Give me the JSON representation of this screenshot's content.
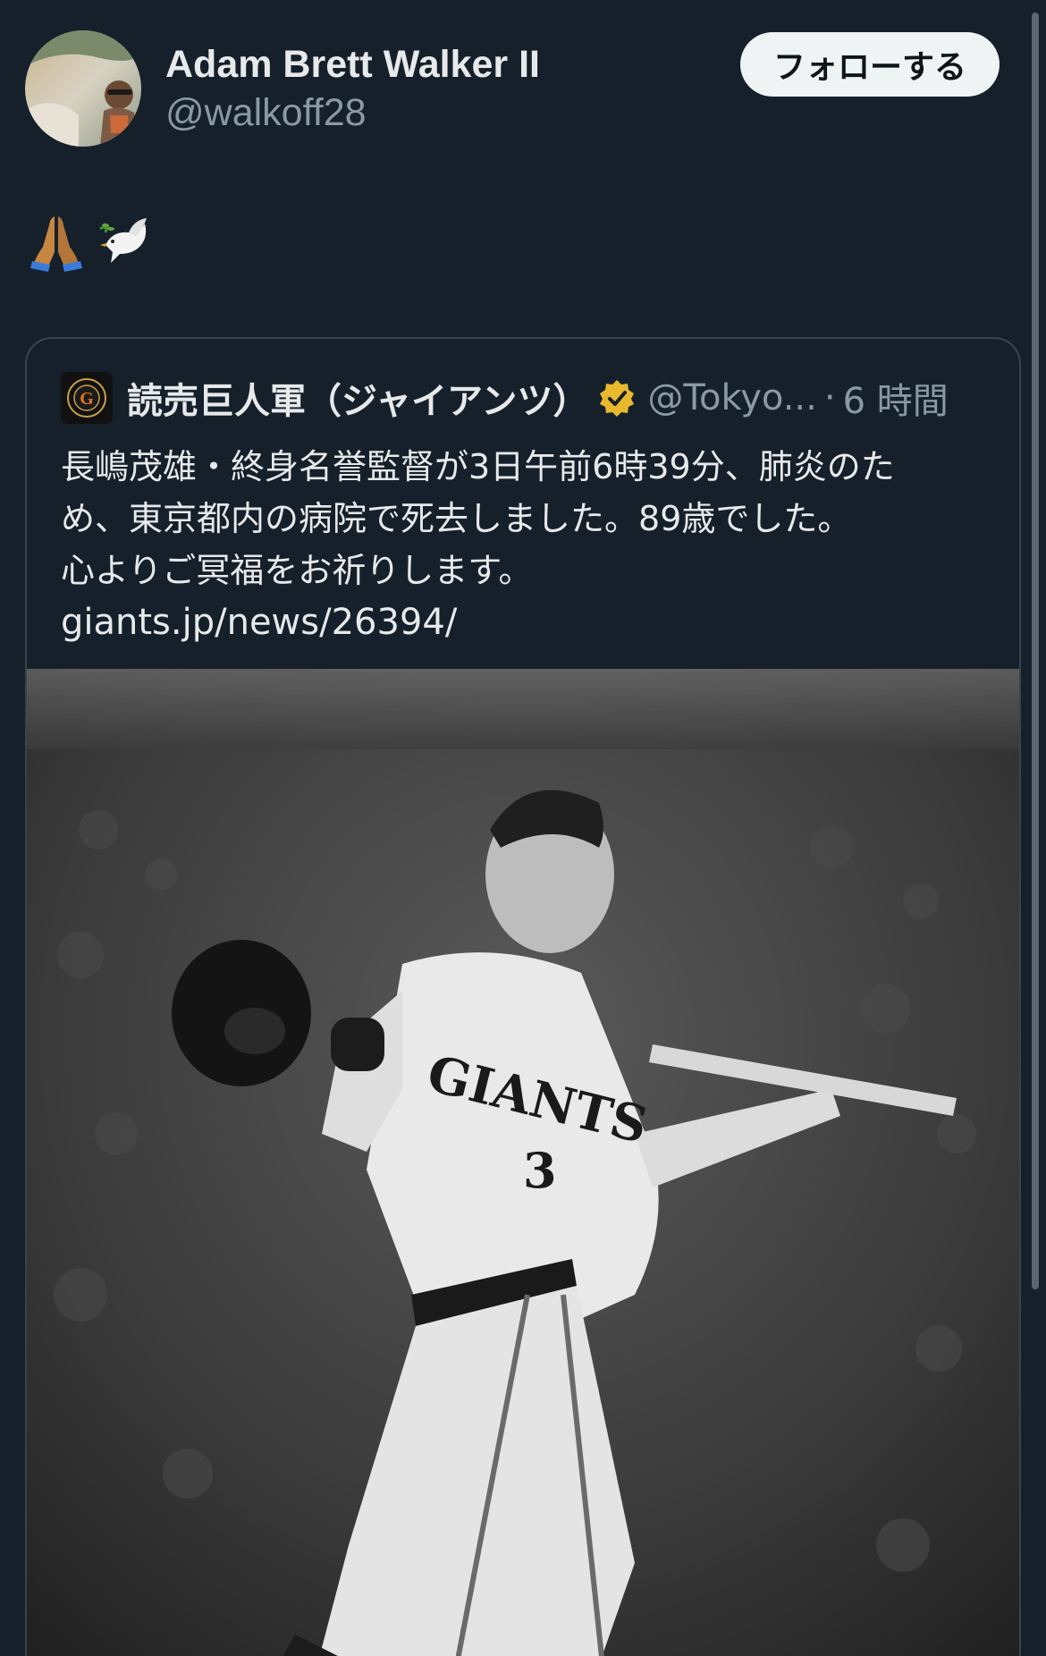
{
  "author": {
    "name": "Adam Brett Walker II",
    "handle": "@walkoff28"
  },
  "follow_button": {
    "label": "フォローする"
  },
  "tweet": {
    "emojis": [
      "folded-hands-emoji",
      "dove-emoji"
    ]
  },
  "quote": {
    "name": "読売巨人軍（ジャイアンツ）",
    "handle": "@Tokyo...",
    "separator": "·",
    "time": "6 時間",
    "text_lines": [
      "長嶋茂雄・終身名誉監督が3日午前6時39分、肺炎のた",
      "め、東京都内の病院で死去しました。89歳でした。",
      "心よりご冥福をお祈りします。"
    ],
    "link": "giants.jp/news/26394/",
    "photo": {
      "jersey_text": "GIANTS",
      "jersey_number": "3"
    }
  },
  "colors": {
    "background": "#15202b",
    "text_primary": "#e7e9ea",
    "text_secondary": "#8b98a5",
    "border": "#38444d",
    "verified_gold": "#e8b92e"
  }
}
